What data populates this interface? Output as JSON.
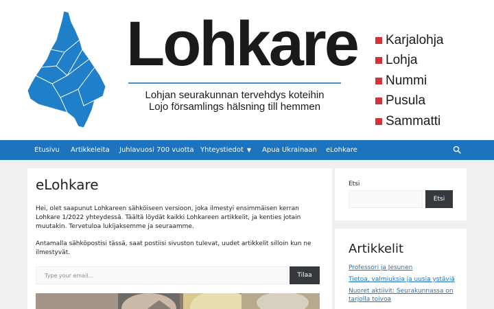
{
  "header": {
    "brand_title": "Lohkare",
    "tagline_fi": "Lohjan seurakunnan tervehdys koteihin",
    "tagline_sv": "Lojo församlings hälsning till hemmen",
    "parishes": [
      "Karjalohja",
      "Lohja",
      "Nummi",
      "Pusula",
      "Sammatti"
    ],
    "parish_marker_color": "#d0343a",
    "map_color": "#1f7fc9"
  },
  "nav": {
    "items": [
      {
        "label": "Etusivu"
      },
      {
        "label": "Artikkeleita"
      },
      {
        "label": "Juhlavuosi 700 vuotta"
      },
      {
        "label": "Yhteystiedot",
        "has_dropdown": true
      },
      {
        "label": "Apua Ukrainaan"
      },
      {
        "label": "eLohkare"
      }
    ],
    "search_icon": "search-icon",
    "background_color": "#1e73be"
  },
  "main": {
    "title": "eLohkare",
    "intro": "Hei, olet saapunut Lohkareen sähköiseen versioon, joka ilmestyi ensimmäisen kerran Lohkare 1/2022 yhteydessä. Täältä löydät kaikki Lohkareen artikkelit, ja kenties jotain muutakin. Tervetuloa lukijaksemme ja seuraamme.",
    "subscribe_text": "Antamalla sähköpostisi tässä, saat postiisi sivuston tulevat, uudet artikkelit silloin kun ne ilmestyvät.",
    "email_placeholder": "Type your email...",
    "subscribe_button": "Tilaa"
  },
  "sidebar": {
    "search_label": "Etsi",
    "search_button": "Etsi",
    "articles_title": "Artikkelit",
    "articles": [
      "Professori ja Jesunen",
      "Tietoa, valmiuksia ja uusia ystäviä",
      "Nuoret aktiivit: Seurakunnassa on tarjolla toivoa"
    ],
    "link_color": "#1e73be"
  }
}
